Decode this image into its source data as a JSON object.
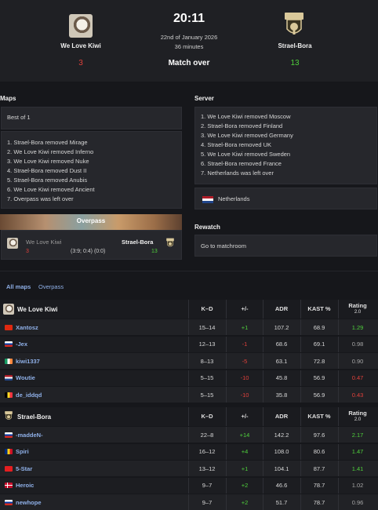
{
  "match": {
    "team1": {
      "name": "We Love Kiwi",
      "score": "3"
    },
    "team2": {
      "name": "Strael-Bora",
      "score": "13",
      "logo_text": "STRAEL BORA"
    },
    "time": "20:11",
    "date": "22nd of January 2026",
    "duration": "36 minutes",
    "status": "Match over"
  },
  "maps": {
    "title": "Maps",
    "format": "Best of 1",
    "veto": [
      "1. Strael-Bora removed Mirage",
      "2. We Love Kiwi removed Inferno",
      "3. We Love Kiwi removed Nuke",
      "4. Strael-Bora removed Dust II",
      "5. Strael-Bora removed Anubis",
      "6. We Love Kiwi removed Ancient",
      "7. Overpass was left over"
    ],
    "played": {
      "name": "Overpass",
      "team1": "We Love Kiwi",
      "team1_score": "3",
      "team2": "Strael-Bora",
      "team2_score": "13",
      "halves": "(3:9; 0:4) (0:0)"
    }
  },
  "server": {
    "title": "Server",
    "veto": [
      "1. We Love Kiwi removed Moscow",
      "2. Strael-Bora removed Finland",
      "3. We Love Kiwi removed Germany",
      "4. Strael-Bora removed UK",
      "5. We Love Kiwi removed Sweden",
      "6. Strael-Bora removed France",
      "7. Netherlands was left over"
    ],
    "location": "Netherlands"
  },
  "rewatch": {
    "title": "Rewatch",
    "link": "Go to matchroom"
  },
  "stats_tabs": {
    "all": "All maps",
    "map": "Overpass"
  },
  "columns": {
    "kd": "K–D",
    "pm": "+/-",
    "adr": "ADR",
    "kast": "KAST %",
    "rating": "Rating",
    "rating_sub": "2.0"
  },
  "team1_stats": {
    "name": "We Love Kiwi",
    "players": [
      {
        "name": "Xantosz",
        "flag": "cn",
        "kd": "15–14",
        "pm": "+1",
        "pm_c": "pos",
        "adr": "107.2",
        "kast": "68.9",
        "rating": "1.29",
        "r_c": "pos"
      },
      {
        "name": "-Jex",
        "flag": "ru",
        "kd": "12–13",
        "pm": "-1",
        "pm_c": "neg",
        "adr": "68.6",
        "kast": "69.1",
        "rating": "0.98",
        "r_c": "neu"
      },
      {
        "name": "kiwi1337",
        "flag": "ie",
        "kd": "8–13",
        "pm": "-5",
        "pm_c": "neg",
        "adr": "63.1",
        "kast": "72.8",
        "rating": "0.90",
        "r_c": "neu"
      },
      {
        "name": "Woutie",
        "flag": "nl",
        "kd": "5–15",
        "pm": "-10",
        "pm_c": "neg",
        "adr": "45.8",
        "kast": "56.9",
        "rating": "0.47",
        "r_c": "neg"
      },
      {
        "name": "de_iddqd",
        "flag": "be",
        "kd": "5–15",
        "pm": "-10",
        "pm_c": "neg",
        "adr": "35.8",
        "kast": "56.9",
        "rating": "0.43",
        "r_c": "neg"
      }
    ]
  },
  "team2_stats": {
    "name": "Strael-Bora",
    "players": [
      {
        "name": "-maddeN-",
        "flag": "ru",
        "kd": "22–8",
        "pm": "+14",
        "pm_c": "pos",
        "adr": "142.2",
        "kast": "97.6",
        "rating": "2.17",
        "r_c": "pos"
      },
      {
        "name": "Spiri",
        "flag": "ro",
        "kd": "16–12",
        "pm": "+4",
        "pm_c": "pos",
        "adr": "108.0",
        "kast": "80.6",
        "rating": "1.47",
        "r_c": "pos"
      },
      {
        "name": "5-Star",
        "flag": "al",
        "kd": "13–12",
        "pm": "+1",
        "pm_c": "pos",
        "adr": "104.1",
        "kast": "87.7",
        "rating": "1.41",
        "r_c": "pos"
      },
      {
        "name": "Heroic",
        "flag": "dk",
        "kd": "9–7",
        "pm": "+2",
        "pm_c": "pos",
        "adr": "46.6",
        "kast": "78.7",
        "rating": "1.02",
        "r_c": "neu"
      },
      {
        "name": "newhope",
        "flag": "ru",
        "kd": "9–7",
        "pm": "+2",
        "pm_c": "pos",
        "adr": "51.7",
        "kast": "78.7",
        "rating": "0.96",
        "r_c": "neu"
      }
    ]
  },
  "colors": {
    "positive": "#4fcf3c",
    "negative": "#e0413b",
    "neutral": "#a6a6a6",
    "link": "#8fb0e8"
  }
}
